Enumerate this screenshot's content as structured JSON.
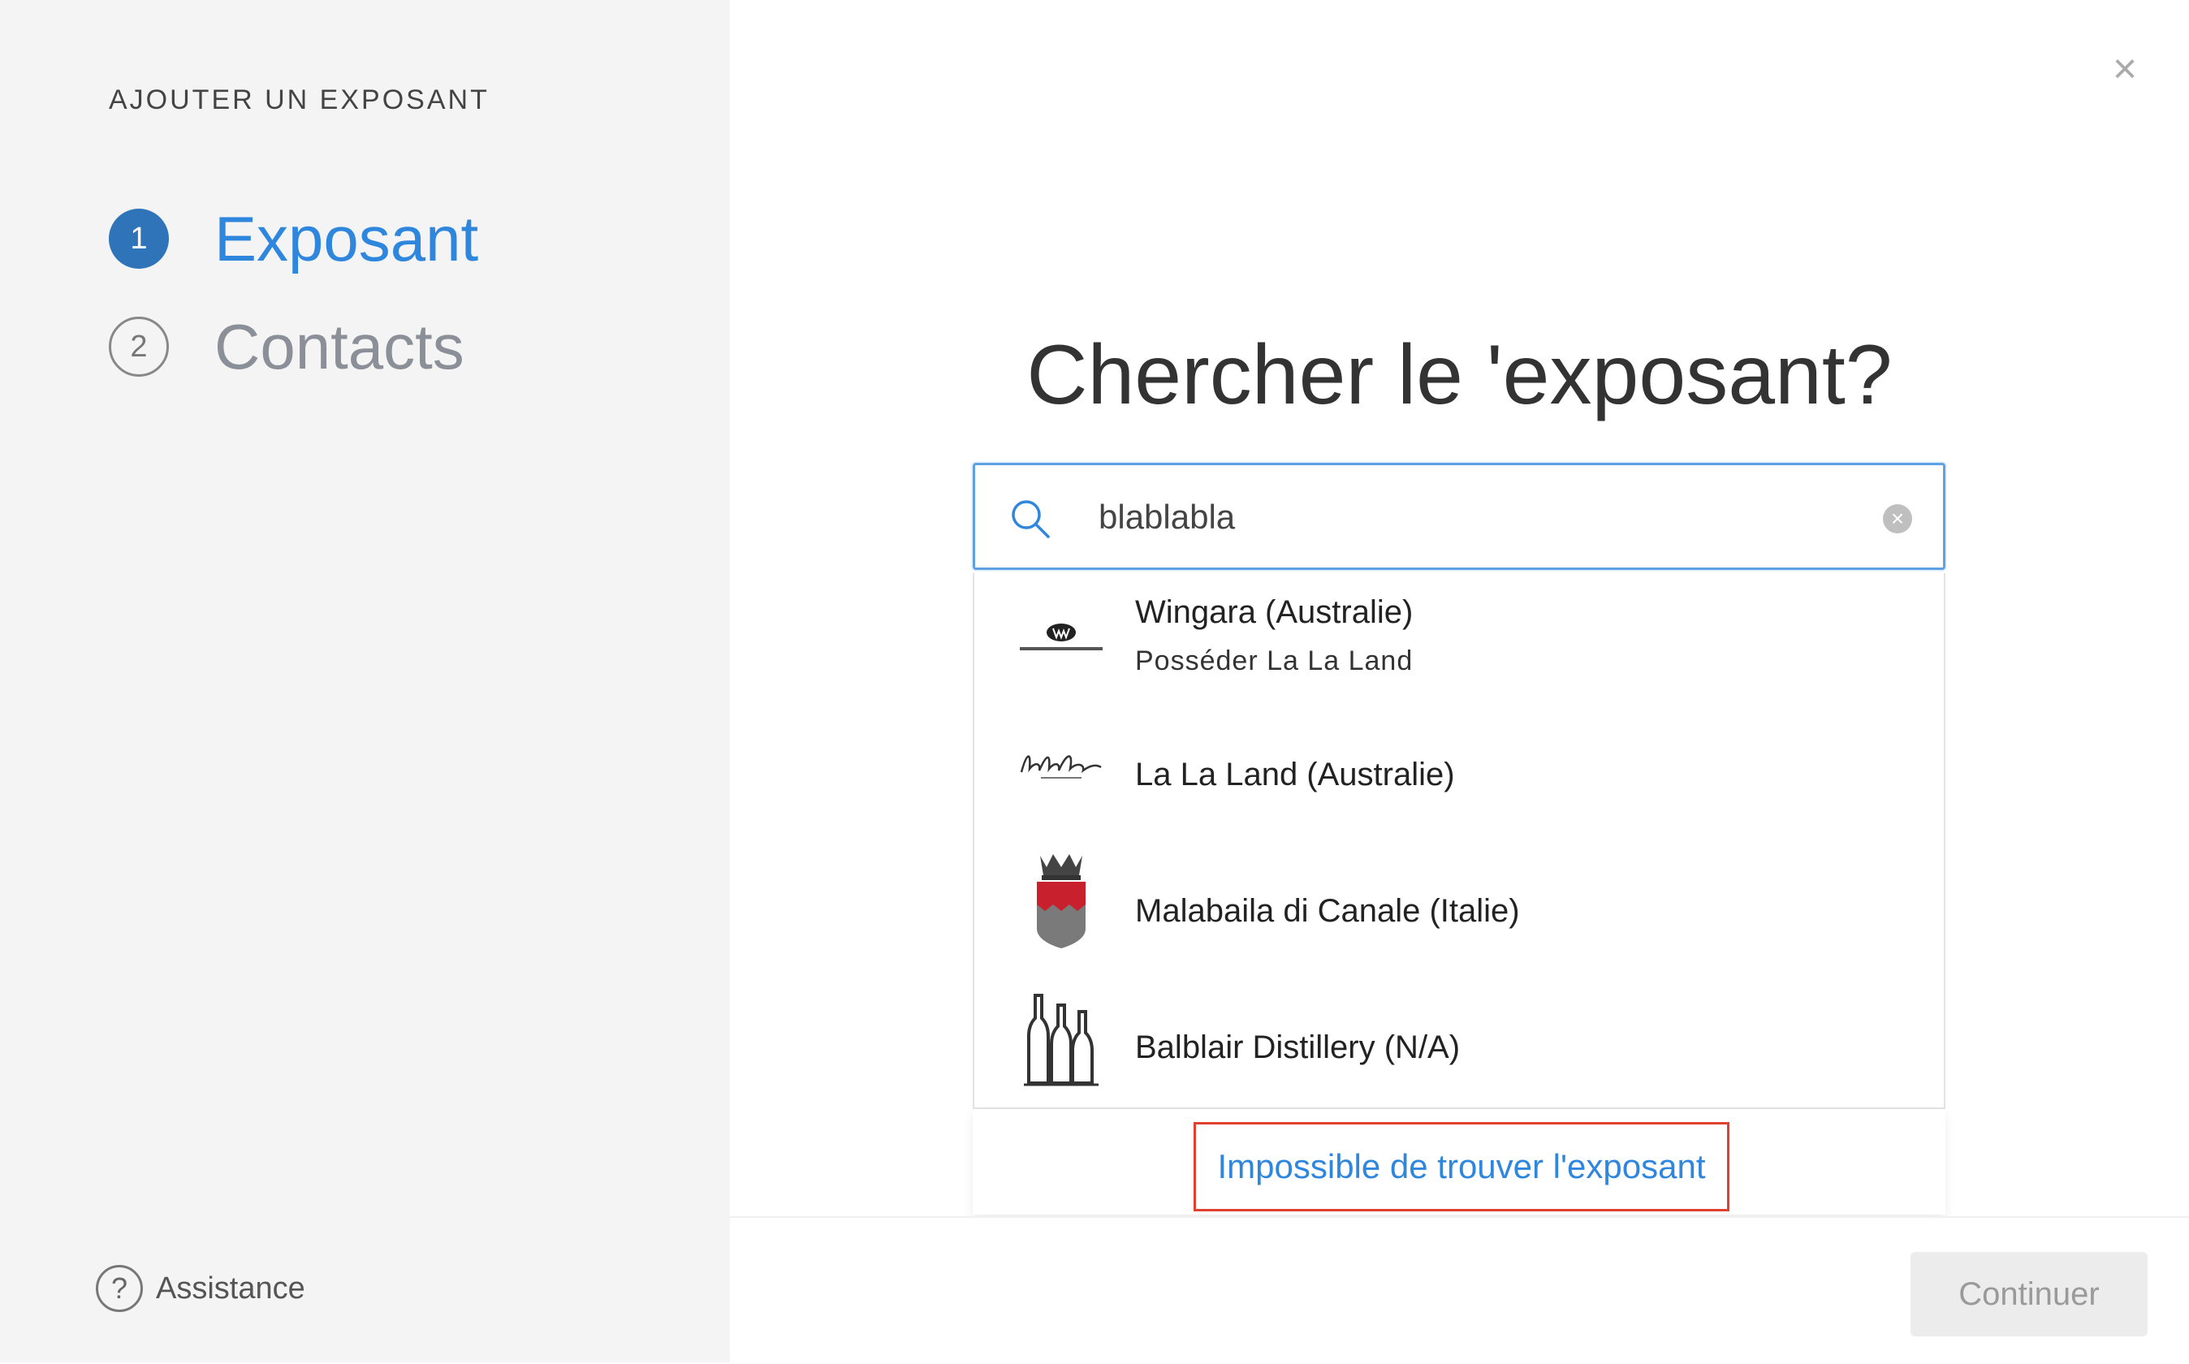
{
  "sidebar": {
    "title": "AJOUTER UN EXPOSANT",
    "steps": [
      {
        "number": "1",
        "label": "Exposant",
        "state": "active"
      },
      {
        "number": "2",
        "label": "Contacts",
        "state": "inactive"
      }
    ],
    "assistance_label": "Assistance"
  },
  "main": {
    "close_icon": "×",
    "heading": "Chercher le 'exposant?",
    "search": {
      "value": "blablabla",
      "clear_icon": "×"
    },
    "results": [
      {
        "name": "Wingara (Australie)",
        "subtitle": "Posséder La La Land",
        "logo": "wingara-logo"
      },
      {
        "name": "La La Land (Australie)",
        "subtitle": "",
        "logo": "la-la-land-logo"
      },
      {
        "name": "Malabaila di Canale (Italie)",
        "subtitle": "",
        "logo": "malabaila-crest-logo"
      },
      {
        "name": "Balblair Distillery (N/A)",
        "subtitle": "",
        "logo": "balblair-bottles-logo"
      }
    ],
    "not_found_link": "Impossible de trouver l'exposant"
  },
  "footer": {
    "continue_label": "Continuer"
  },
  "colors": {
    "accent_blue": "#2f86dd",
    "step_active_bg": "#2f73b9",
    "highlight_red": "#e0402f",
    "sidebar_bg": "#f4f4f4"
  }
}
